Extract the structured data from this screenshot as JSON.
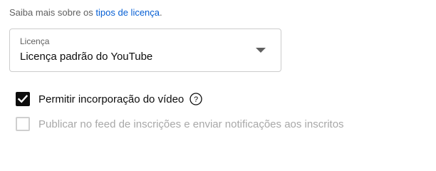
{
  "learn_more": {
    "prefix": "Saiba mais sobre os ",
    "link": "tipos de licença",
    "suffix": "."
  },
  "license_select": {
    "label": "Licença",
    "value": "Licença padrão do YouTube",
    "icon": "dropdown-arrow-icon"
  },
  "embed_option": {
    "label": "Permitir incorporação do vídeo",
    "checked": true,
    "help_icon": "help-circle-icon",
    "help_glyph": "?"
  },
  "feed_option": {
    "label": "Publicar no feed de inscrições e enviar notificações aos inscritos",
    "checked": false,
    "disabled": true
  },
  "colors": {
    "link": "#065fd4",
    "text": "#0d0d0d",
    "secondary_text": "#606060",
    "disabled_text": "#a8a8a8"
  }
}
